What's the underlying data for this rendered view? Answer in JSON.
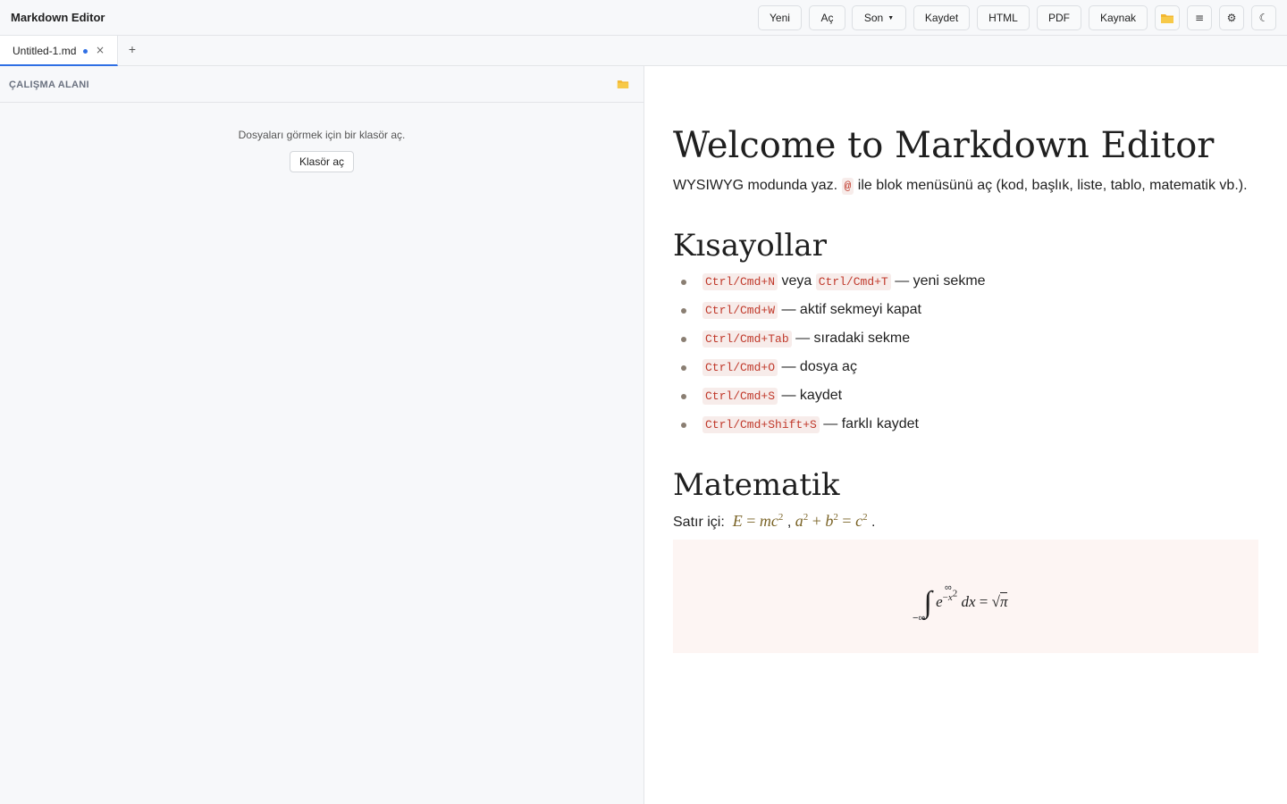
{
  "app": {
    "title": "Markdown Editor"
  },
  "toolbar": {
    "new_label": "Yeni",
    "open_label": "Aç",
    "recent_label": "Son",
    "save_label": "Kaydet",
    "html_label": "HTML",
    "pdf_label": "PDF",
    "source_label": "Kaynak",
    "icons": [
      "folder-icon",
      "menu-icon",
      "gear-icon",
      "moon-icon"
    ]
  },
  "tabs": {
    "items": [
      {
        "label": "Untitled-1.md",
        "unsaved": true,
        "active": true
      }
    ],
    "add_label": "+"
  },
  "sidebar": {
    "title": "ÇALIŞMA ALANI",
    "empty_text": "Dosyaları görmek için bir klasör aç.",
    "open_folder_label": "Klasör aç"
  },
  "document": {
    "h1": "Welcome to Markdown Editor",
    "intro": {
      "before": "WYSIWYG modunda yaz.",
      "code": "@",
      "after": "ile blok menüsünü aç (kod, başlık, liste, tablo, matematik vb.)."
    },
    "shortcuts_heading": "Kısayollar",
    "shortcuts": [
      {
        "code1": "Ctrl/Cmd+N",
        "mid": "veya",
        "code2": "Ctrl/Cmd+T",
        "text": "— yeni sekme"
      },
      {
        "code1": "Ctrl/Cmd+W",
        "text": "— aktif sekmeyi kapat"
      },
      {
        "code1": "Ctrl/Cmd+Tab",
        "text": "— sıradaki sekme"
      },
      {
        "code1": "Ctrl/Cmd+O",
        "text": "— dosya aç"
      },
      {
        "code1": "Ctrl/Cmd+S",
        "text": "— kaydet"
      },
      {
        "code1": "Ctrl/Cmd+Shift+S",
        "text": "— farklı kaydet"
      }
    ],
    "math_heading": "Matematik",
    "inline_label": "Satır içi:",
    "inline_math": [
      "E = mc²",
      "a² + b² = c²"
    ],
    "display_math": "∫₋∞^∞ e^(−x²) dx = √π"
  },
  "colors": {
    "accent": "#2f6fe4",
    "code_text": "#c0392b",
    "code_bg": "#f7ecea",
    "math_inline": "#7a6326",
    "display_bg": "#fdf5f3",
    "folder": "#f2b630"
  }
}
